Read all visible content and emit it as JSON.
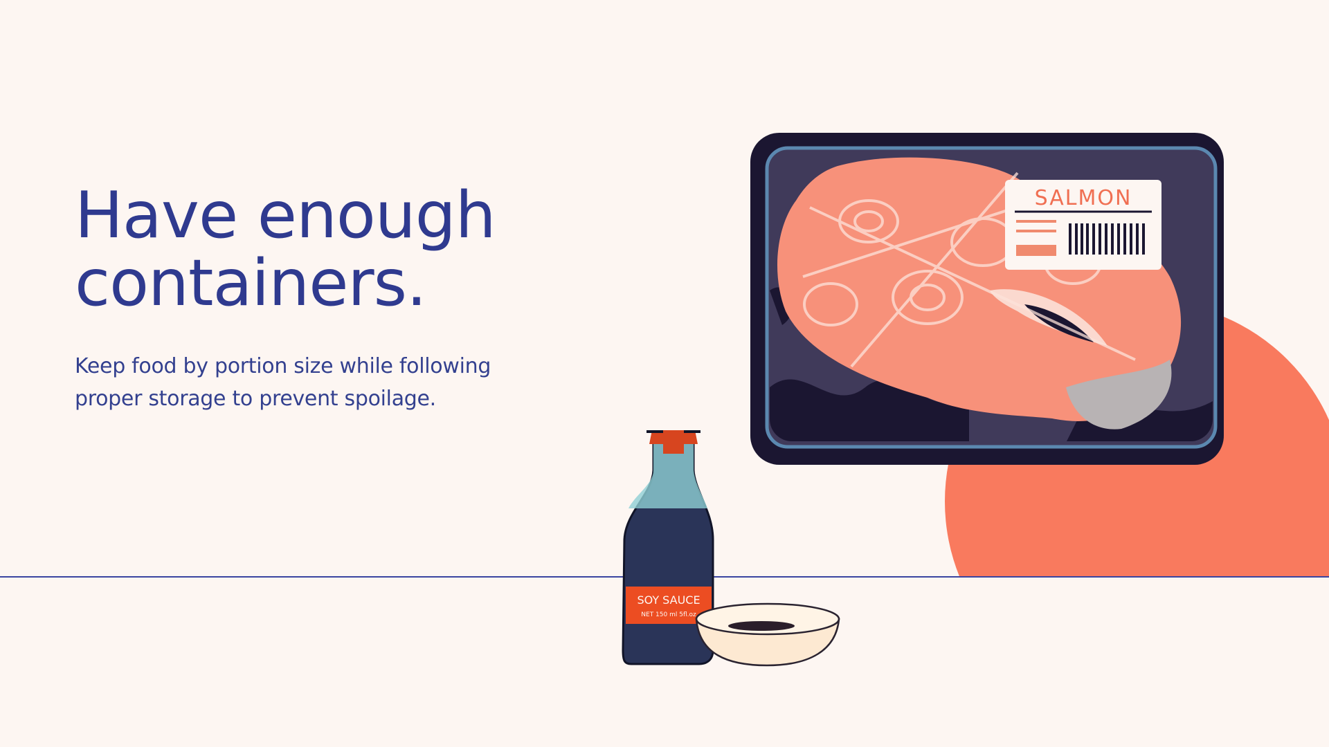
{
  "slide": {
    "title": "Have enough containers.",
    "body": "Keep food by portion size while following proper storage to prevent spoilage."
  },
  "illustration": {
    "tray_label": "SALMON",
    "bottle_label": "SOY SAUCE",
    "bottle_net": "NET 150 ml 5fl.oz"
  },
  "colors": {
    "background": "#fdf6f2",
    "title": "#2f3a8f",
    "accent_circle": "#f97a5e",
    "baseline": "#3a44a0",
    "tray": "#1b1631",
    "salmon": "#f7917a"
  }
}
